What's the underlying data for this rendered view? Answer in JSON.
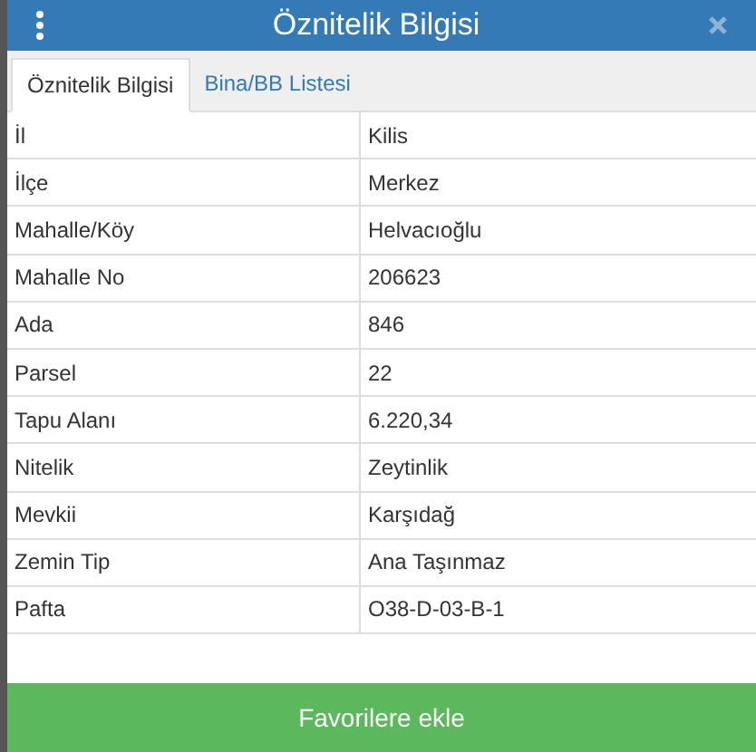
{
  "header": {
    "title": "Öznitelik Bilgisi"
  },
  "tabs": [
    {
      "label": "Öznitelik Bilgisi",
      "selected": true
    },
    {
      "label": "Bina/BB Listesi",
      "selected": false
    }
  ],
  "rows": [
    {
      "label": "İl",
      "value": "Kilis"
    },
    {
      "label": "İlçe",
      "value": "Merkez"
    },
    {
      "label": "Mahalle/Köy",
      "value": "Helvacıoğlu"
    },
    {
      "label": "Mahalle No",
      "value": "206623"
    },
    {
      "label": "Ada",
      "value": "846"
    },
    {
      "label": "Parsel",
      "value": "22"
    },
    {
      "label": "Tapu Alanı",
      "value": "6.220,34"
    },
    {
      "label": "Nitelik",
      "value": "Zeytinlik"
    },
    {
      "label": "Mevkii",
      "value": "Karşıdağ"
    },
    {
      "label": "Zemin Tip",
      "value": "Ana Taşınmaz"
    },
    {
      "label": "Pafta",
      "value": "O38-D-03-B-1"
    }
  ],
  "action_button": "Favorilere ekle"
}
